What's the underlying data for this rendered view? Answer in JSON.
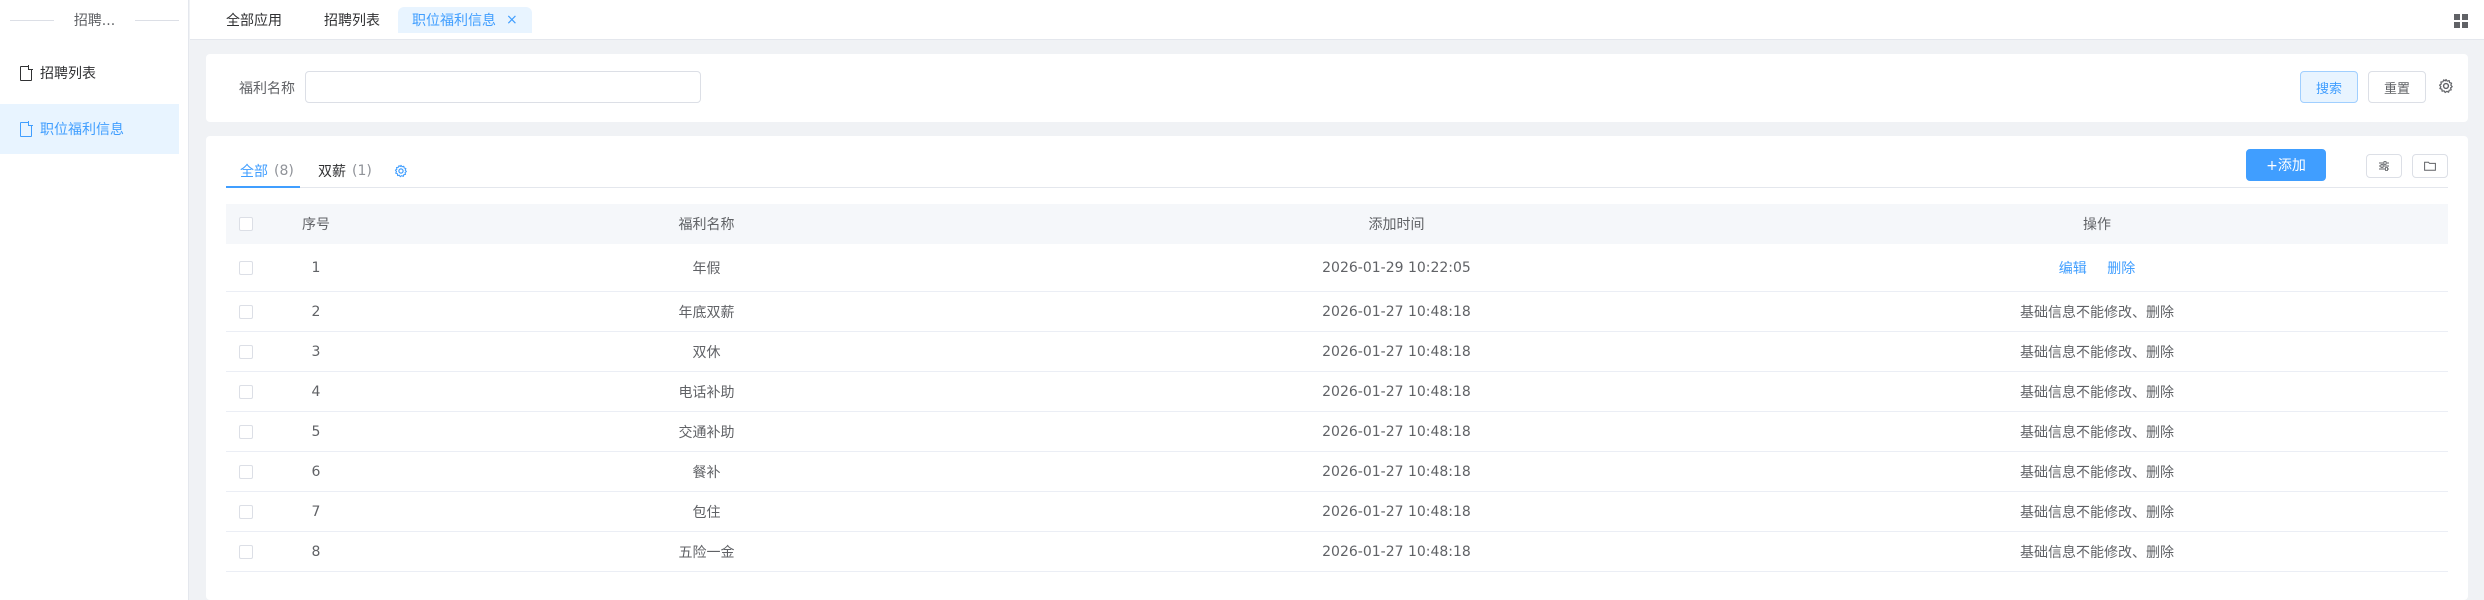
{
  "sidebar": {
    "title": "招聘...",
    "items": [
      {
        "label": "招聘列表"
      },
      {
        "label": "职位福利信息"
      }
    ]
  },
  "tabs": {
    "items": [
      {
        "label": "全部应用"
      },
      {
        "label": "招聘列表"
      },
      {
        "label": "职位福利信息"
      }
    ],
    "close_glyph": "×"
  },
  "search": {
    "label": "福利名称",
    "value": "",
    "placeholder": "",
    "search_button": "搜索",
    "reset_button": "重置"
  },
  "filter_tabs": [
    {
      "label": "全部",
      "count": "(8)"
    },
    {
      "label": "双薪",
      "count": "(1)"
    }
  ],
  "toolbar": {
    "add_button": "+添加"
  },
  "table": {
    "columns": [
      "序号",
      "福利名称",
      "添加时间",
      "操作"
    ],
    "rows": [
      {
        "idx": "1",
        "name": "年假",
        "time": "2026-01-29 10:22:05",
        "edit": "编辑",
        "delete": "删除"
      },
      {
        "idx": "2",
        "name": "年底双薪",
        "time": "2026-01-27 10:48:18",
        "op": "基础信息不能修改、删除"
      },
      {
        "idx": "3",
        "name": "双休",
        "time": "2026-01-27 10:48:18",
        "op": "基础信息不能修改、删除"
      },
      {
        "idx": "4",
        "name": "电话补助",
        "time": "2026-01-27 10:48:18",
        "op": "基础信息不能修改、删除"
      },
      {
        "idx": "5",
        "name": "交通补助",
        "time": "2026-01-27 10:48:18",
        "op": "基础信息不能修改、删除"
      },
      {
        "idx": "6",
        "name": "餐补",
        "time": "2026-01-27 10:48:18",
        "op": "基础信息不能修改、删除"
      },
      {
        "idx": "7",
        "name": "包住",
        "time": "2026-01-27 10:48:18",
        "op": "基础信息不能修改、删除"
      },
      {
        "idx": "8",
        "name": "五险一金",
        "time": "2026-01-27 10:48:18",
        "op": "基础信息不能修改、删除"
      }
    ]
  },
  "colors": {
    "accent": "#409eff",
    "active_bg": "#e8f4ff"
  }
}
